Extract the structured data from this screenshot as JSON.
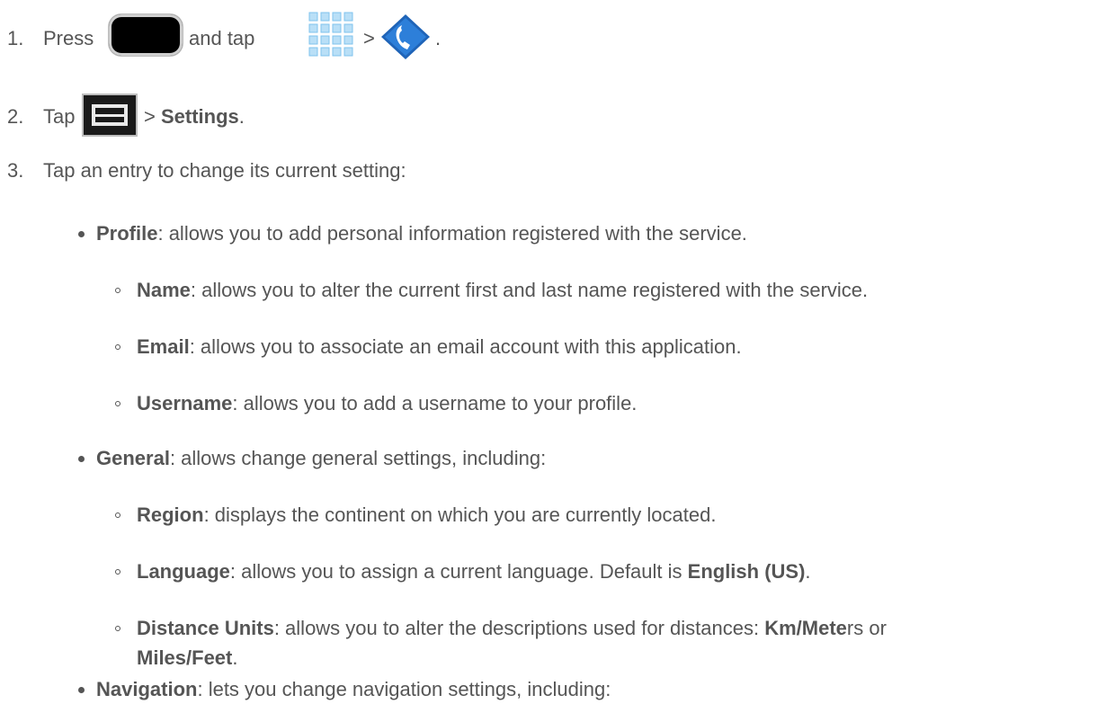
{
  "steps": [
    {
      "number": "1.",
      "press": "Press",
      "and_tap": "and tap",
      "sep": ">",
      "end": "."
    },
    {
      "number": "2.",
      "tap": "Tap",
      "sep": ">",
      "settings": "Settings",
      "end": "."
    },
    {
      "number": "3.",
      "text": "Tap an entry to change its current setting:"
    }
  ],
  "profile": {
    "term": "Profile",
    "desc": ": allows you to add personal information registered with the service.",
    "items": [
      {
        "term": "Name",
        "desc": ": allows you to alter the current first and last name registered with the service."
      },
      {
        "term": "Email",
        "desc": ": allows you to associate an email account with this application."
      },
      {
        "term": "Username",
        "desc": ": allows you to add a username to your profile."
      }
    ]
  },
  "general": {
    "term": "General",
    "desc": ": allows change general settings, including:",
    "items": [
      {
        "term": "Region",
        "desc": ": displays the continent on which you are currently located."
      },
      {
        "term": "Language",
        "desc": ": allows you to assign a current language. Default is ",
        "value": "English (US)",
        "end": "."
      },
      {
        "term": "Distance Units",
        "desc": ": allows you to alter the descriptions used for distances: ",
        "opt1_bold": "Km/Mete",
        "opt1_rest": "rs or",
        "opt2": "Miles/Feet",
        "end": "."
      }
    ]
  },
  "navigation": {
    "term": "Navigation",
    "desc": ": lets you change navigation settings, including:"
  },
  "icons": [
    "home-key-icon",
    "apps-grid-icon",
    "navigation-app-icon",
    "menu-key-icon"
  ]
}
